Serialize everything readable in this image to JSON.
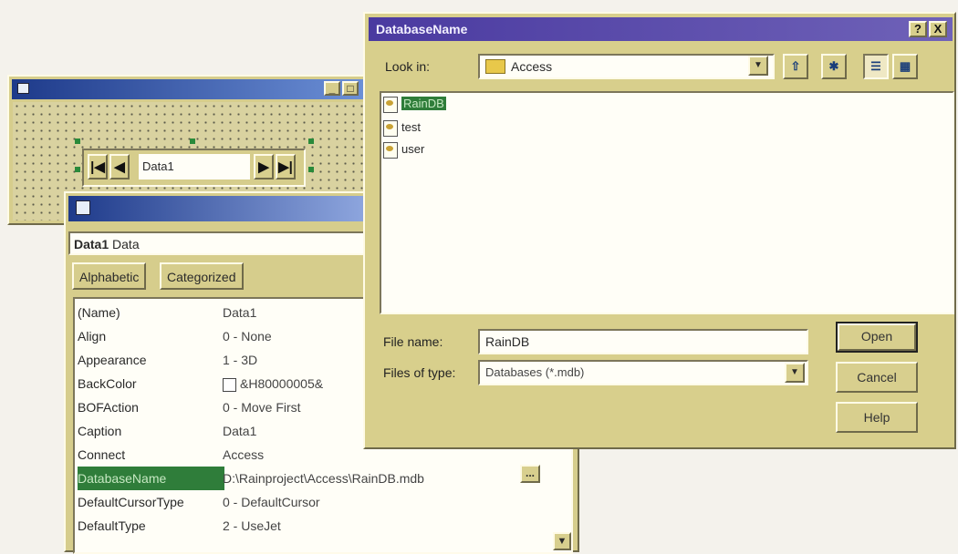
{
  "form_window": {
    "title": "",
    "controls": {
      "minimize": "_",
      "restore": "□"
    },
    "data_control": {
      "caption": "Data1",
      "nav": {
        "first": "|◀",
        "prev": "◀",
        "next": "▶",
        "last": "▶|"
      }
    }
  },
  "properties": {
    "title": "",
    "object": {
      "name": "Data1",
      "type": "Data"
    },
    "tabs": [
      {
        "label": "Alphabetic"
      },
      {
        "label": "Categorized"
      }
    ],
    "rows": [
      {
        "name": "(Name)",
        "value": "Data1"
      },
      {
        "name": "Align",
        "value": "0 - None"
      },
      {
        "name": "Appearance",
        "value": "1 - 3D"
      },
      {
        "name": "BackColor",
        "value": "&H80000005&"
      },
      {
        "name": "BOFAction",
        "value": "0 - Move First"
      },
      {
        "name": "Caption",
        "value": "Data1"
      },
      {
        "name": "Connect",
        "value": "Access"
      },
      {
        "name": "DatabaseName",
        "value": "D:\\Rainproject\\Access\\RainDB.mdb"
      },
      {
        "name": "DefaultCursorType",
        "value": "0 - DefaultCursor"
      },
      {
        "name": "DefaultType",
        "value": "2 - UseJet"
      }
    ],
    "builder_button": "...",
    "scroll_down": "▼"
  },
  "dialog": {
    "title": "DatabaseName",
    "help_btn": "?",
    "close_btn": "X",
    "look_in_label": "Look in:",
    "look_in_value": "Access",
    "dropdown_glyph": "▼",
    "toolbar": {
      "up_folder": "⇧",
      "new_folder": "✱",
      "list_view": "☰",
      "details_view": "▦"
    },
    "files": [
      {
        "name": "RainDB",
        "selected": true
      },
      {
        "name": "test",
        "selected": false
      },
      {
        "name": "user",
        "selected": false
      }
    ],
    "file_name_label": "File name:",
    "file_name_value": "RainDB",
    "files_of_type_label": "Files of type:",
    "files_of_type_value": "Databases (*.mdb)",
    "buttons": {
      "open": "Open",
      "cancel": "Cancel",
      "help": "Help"
    }
  }
}
